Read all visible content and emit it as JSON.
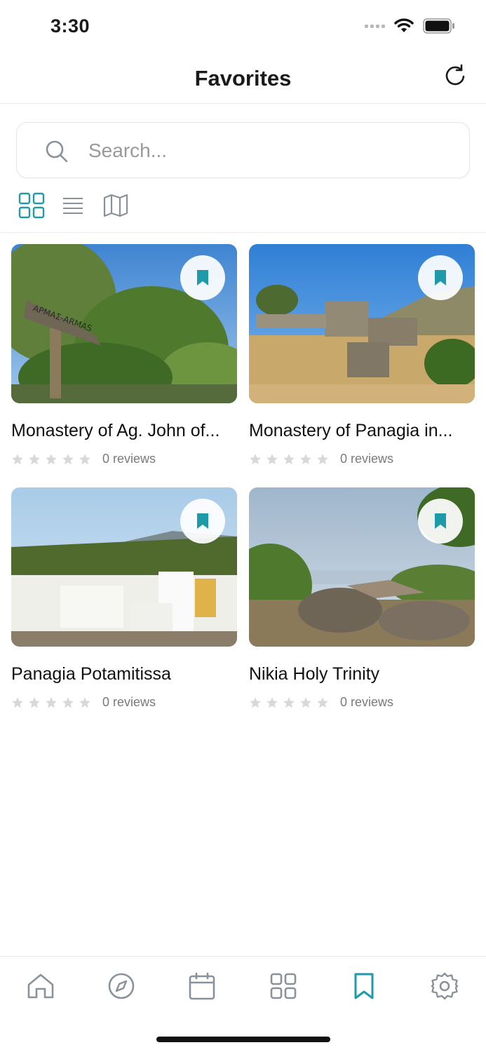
{
  "status_bar": {
    "time": "3:30"
  },
  "header": {
    "title": "Favorites"
  },
  "search": {
    "placeholder": "Search..."
  },
  "view_modes": [
    "grid",
    "list",
    "map"
  ],
  "active_view": "grid",
  "colors": {
    "accent": "#1e9aa8",
    "icon_gray": "#8a9299"
  },
  "favorites": [
    {
      "title": "Monastery of Ag. John of...",
      "rating": 0,
      "reviews": "0 reviews"
    },
    {
      "title": "Monastery of Panagia in...",
      "rating": 0,
      "reviews": "0 reviews"
    },
    {
      "title": "Panagia Potamitissa",
      "rating": 0,
      "reviews": "0 reviews"
    },
    {
      "title": "Nikia Holy Trinity",
      "rating": 0,
      "reviews": "0 reviews"
    }
  ],
  "tab_bar": {
    "items": [
      {
        "icon": "home-icon"
      },
      {
        "icon": "compass-icon"
      },
      {
        "icon": "calendar-icon"
      },
      {
        "icon": "categories-icon"
      },
      {
        "icon": "bookmark-icon",
        "active": true
      },
      {
        "icon": "settings-icon"
      }
    ]
  }
}
